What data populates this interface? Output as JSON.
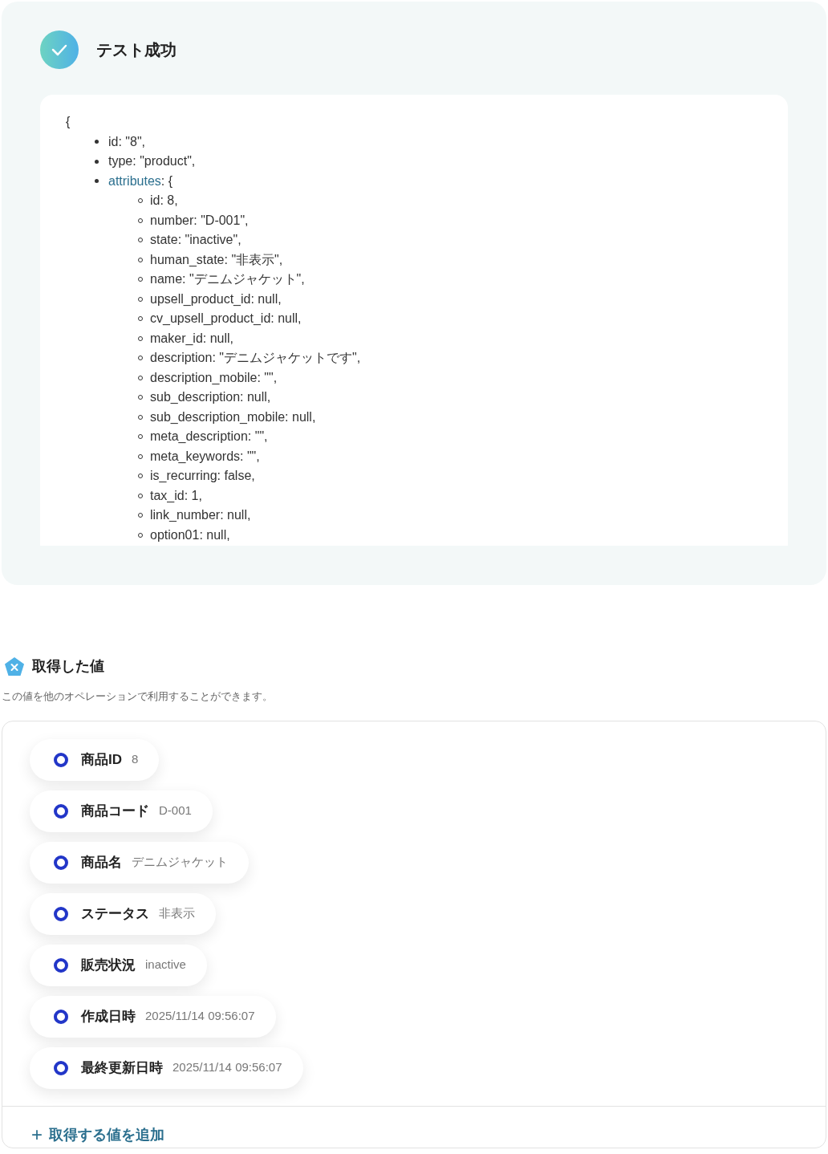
{
  "test_result": {
    "title": "テスト成功",
    "open_brace": "{",
    "items": [
      {
        "kind": "value",
        "text": "id: \"8\","
      },
      {
        "kind": "value",
        "text": "type: \"product\","
      },
      {
        "kind": "object",
        "key": "attributes",
        "suffix": ": {",
        "children": [
          {
            "text": "id: 8,"
          },
          {
            "text": "number: \"D-001\","
          },
          {
            "text": "state: \"inactive\","
          },
          {
            "text": "human_state: \"非表示\","
          },
          {
            "text": "name: \"デニムジャケット\","
          },
          {
            "text": "upsell_product_id: null,"
          },
          {
            "text": "cv_upsell_product_id: null,"
          },
          {
            "text": "maker_id: null,"
          },
          {
            "text": "description: \"デニムジャケットです\","
          },
          {
            "text": "description_mobile: \"\","
          },
          {
            "text": "sub_description: null,"
          },
          {
            "text": "sub_description_mobile: null,"
          },
          {
            "text": "meta_description: \"\","
          },
          {
            "text": "meta_keywords: \"\","
          },
          {
            "text": "is_recurring: false,"
          },
          {
            "text": "tax_id: 1,"
          },
          {
            "text": "link_number: null,"
          },
          {
            "text": "option01: null,"
          }
        ]
      }
    ]
  },
  "acquired_values": {
    "title": "取得した値",
    "description": "この値を他のオペレーションで利用することができます。",
    "values": [
      {
        "label": "商品ID",
        "value": "8"
      },
      {
        "label": "商品コード",
        "value": "D-001"
      },
      {
        "label": "商品名",
        "value": "デニムジャケット"
      },
      {
        "label": "ステータス",
        "value": "非表示"
      },
      {
        "label": "販売状況",
        "value": "inactive"
      },
      {
        "label": "作成日時",
        "value": "2025/11/14 09:56:07"
      },
      {
        "label": "最終更新日時",
        "value": "2025/11/14 09:56:07"
      }
    ],
    "add_button": {
      "icon": "+",
      "label": "取得する値を追加"
    }
  }
}
